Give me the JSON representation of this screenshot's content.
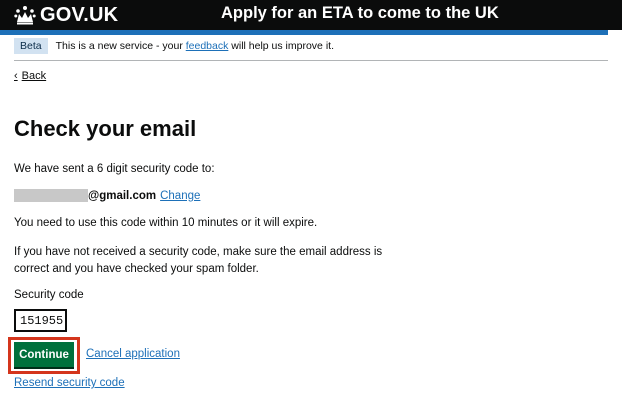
{
  "header": {
    "logo_text": "GOV.UK",
    "service_name": "Apply for an ETA to come to the UK"
  },
  "phase_banner": {
    "tag": "Beta",
    "text_before": "This is a new service - your ",
    "link": "feedback",
    "text_after": " will help us improve it."
  },
  "back_link": "Back",
  "page": {
    "title": "Check your email",
    "sent_text": "We have sent a 6 digit security code to:",
    "email_domain": "@gmail.com",
    "change_link": "Change",
    "expiry_text": "You need to use this code within 10 minutes or it will expire.",
    "spam_text": "If you have not received a security code, make sure the email address is correct and you have checked your spam folder.",
    "code_label": "Security code",
    "code_value": "151955",
    "continue_label": "Continue",
    "cancel_link": "Cancel application",
    "resend_link": "Resend security code"
  },
  "colors": {
    "header_bg": "#0b0c0c",
    "brand_blue": "#1d70b8",
    "button_green": "#00703c",
    "highlight_red": "#d4351c"
  }
}
